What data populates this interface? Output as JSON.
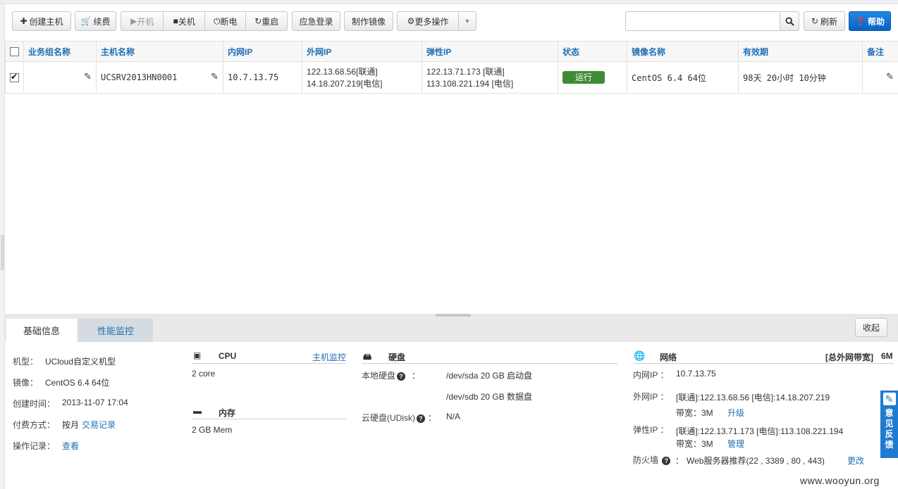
{
  "toolbar": {
    "create": "创建主机",
    "renew": "续费",
    "power": [
      {
        "label": "开机",
        "icon": "play-icon",
        "disabled": true
      },
      {
        "label": "关机",
        "icon": "stop-icon",
        "disabled": false
      },
      {
        "label": "断电",
        "icon": "power-icon",
        "disabled": false
      },
      {
        "label": "重启",
        "icon": "restart-icon",
        "disabled": false
      }
    ],
    "emergency_login": "应急登录",
    "make_image": "制作镜像",
    "more": "更多操作",
    "search_value": "",
    "search_placeholder": "",
    "refresh": "刷新",
    "help": "帮助"
  },
  "table": {
    "headers": [
      "业务组名称",
      "主机名称",
      "内网IP",
      "外网IP",
      "弹性IP",
      "状态",
      "镜像名称",
      "有效期",
      "备注"
    ],
    "rows": [
      {
        "checked": true,
        "group": "",
        "host": "UCSRV2013HN0001",
        "private_ip": "10.7.13.75",
        "public_ip_1": "122.13.68.56[联通]",
        "public_ip_2": "14.18.207.219[电信]",
        "eip_1": "122.13.71.173 [联通]",
        "eip_2": "113.108.221.194 [电信]",
        "status": "运行",
        "image": "CentOS 6.4 64位",
        "validity": "98天 20小时 10分钟",
        "note": ""
      }
    ]
  },
  "panel": {
    "tabs": [
      "基础信息",
      "性能监控"
    ],
    "collapse": "收起",
    "basic": {
      "model_label": "机型：",
      "model_value": "UCloud自定义机型",
      "image_label": "镜像：",
      "image_value": "CentOS 6.4 64位",
      "created_label": "创建时间：",
      "created_value": "2013-11-07 17:04",
      "pay_label": "付费方式：",
      "pay_value": "按月",
      "pay_link": "交易记录",
      "ops_label": "操作记录：",
      "ops_link": "查看"
    },
    "cpu": {
      "title": "CPU",
      "link": "主机监控",
      "value": "2 core"
    },
    "memory": {
      "title": "内存",
      "value": "2 GB Mem"
    },
    "disk": {
      "title": "硬盘",
      "local_label": "本地硬盘",
      "local_1": "/dev/sda 20 GB 启动盘",
      "local_2": "/dev/sdb 20 GB 数据盘",
      "udisk_label": "云硬盘(UDisk)",
      "udisk_value": "N/A",
      "colon": "："
    },
    "network": {
      "title": "网络",
      "bw_label": "[总外网带宽]",
      "bw_value": "6M",
      "private_label": "内网IP ：",
      "private_value": "10.7.13.75",
      "public_label": "外网IP ：",
      "public_value": "[联通]:122.13.68.56 [电信]:14.18.207.219",
      "public_bw": "带宽：3M",
      "public_link": "升级",
      "eip_label": "弹性IP ：",
      "eip_value": "[联通]:122.13.71.173 [电信]:113.108.221.194",
      "eip_bw": "带宽：3M",
      "eip_link": "管理",
      "fw_label": "防火墙",
      "fw_value": "Web服务器推荐(22 , 3389 , 80 , 443)",
      "fw_link": "更改",
      "colon": "："
    }
  },
  "feedback": [
    "意",
    "见",
    "反",
    "馈"
  ],
  "watermark": "www.wooyun.org"
}
